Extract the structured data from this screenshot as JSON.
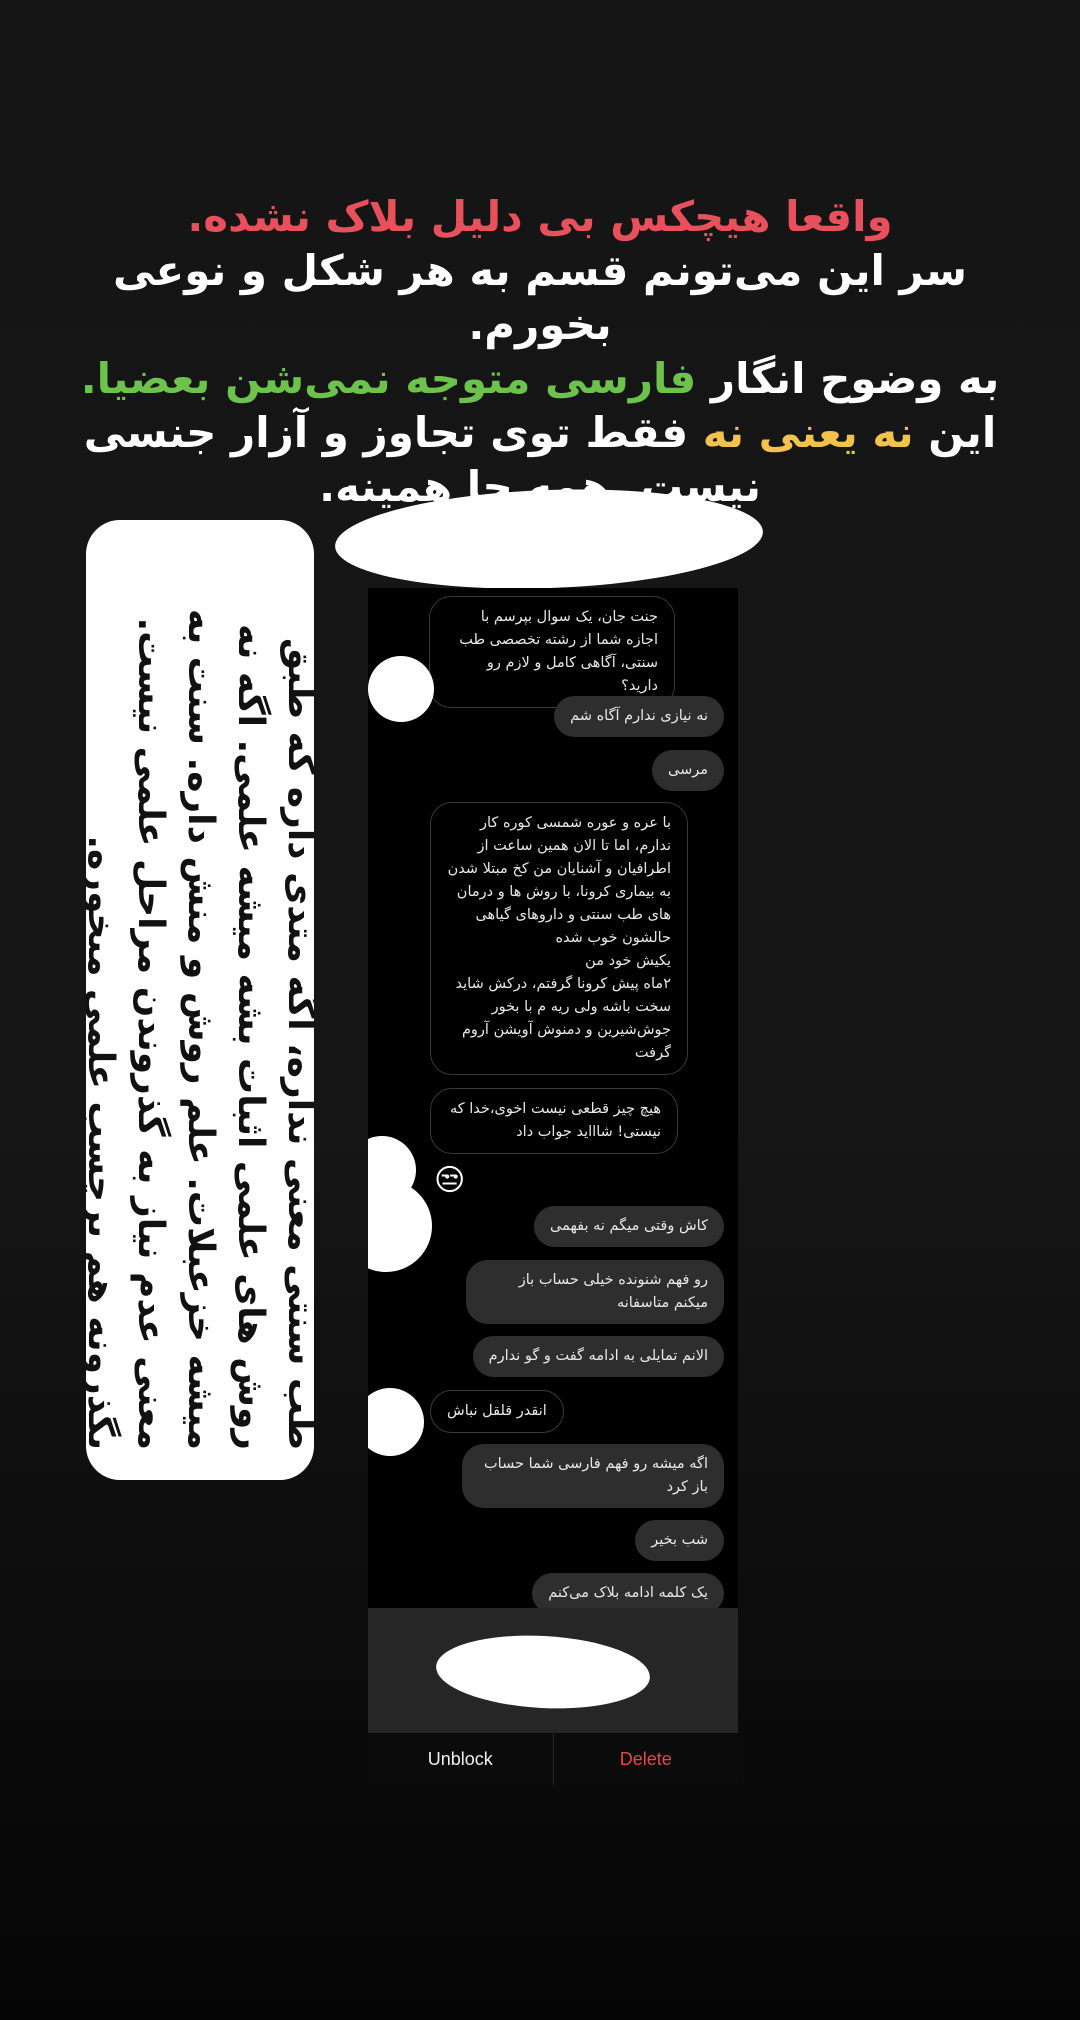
{
  "headline": {
    "line1": "واقعا هیچکس بی دلیل بلاک نشده.",
    "line2": "سر این می‌تونم قسم به هر شکل و نوعی بخورم.",
    "line3_a": "به وضوح انگار ",
    "line3_b": "فارسی متوجه نمی‌شن بعضیا.",
    "line4_a": "این ",
    "line4_b": "نه یعنی نه",
    "line4_c": " فقط توی تجاوز و آزار جنسی",
    "line5": "نیست. همه جا همینه.",
    "colors": {
      "red": "#e8505b",
      "green": "#6cc24a",
      "yellow": "#f2c14e"
    }
  },
  "side_note": {
    "text": "طب سنتی معنی نداره، اگه متدی داره که طبق روش های علمی اثبات بشه میشه علمی. اگه نه میشه خزعبلات. علم روش و منش داره. سنت به معنی عدم نیاز به گذروندن مراحل علمی نیست. بگذرونه هم برچسب علمی میخوره."
  },
  "chat": {
    "messages": [
      {
        "side": "theirs",
        "text": "جنت جان، یک سوال بپرسم با اجازه شما از رشته تخصصی طب سنتی، آگاهی کامل و لازم رو دارید؟"
      },
      {
        "side": "mine",
        "text": "نه نیازی ندارم آگاه شم"
      },
      {
        "side": "mine",
        "text": "مرسی"
      },
      {
        "side": "theirs",
        "text": "با عره و عوره شمسی کوره کار ندارم، اما تا الان همین ساعت  از اطرافیان و آشنایان من کخ مبتلا شدن به بیماری کرونا، با روش ها و درمان های طب سنتی و داروهای گیاهی حالشون خوب شده\nیکیش خود من\n۲ماه پیش کرونا گرفتم، درکش شاید سخت باشه ولی ریه م با بخور جوش‌شیرین  و دمنوش آویشن آروم گرفت"
      },
      {
        "side": "theirs",
        "text": "هیچ چیز قطعی نیست اخوی،خدا که نیستی! شاااید جواب داد"
      },
      {
        "side": "theirs",
        "text": "😒"
      },
      {
        "side": "mine",
        "text": "کاش وقتی میگم نه بفهمی"
      },
      {
        "side": "mine",
        "text": "رو فهم شنونده خیلی حساب باز میکنم متاسفانه"
      },
      {
        "side": "mine",
        "text": "الانم تمایلی به ادامه گفت و گو ندارم"
      },
      {
        "side": "theirs",
        "text": "انقدر قلقل نباش"
      },
      {
        "side": "mine",
        "text": "اگه میشه رو فهم فارسی شما حساب باز کرد"
      },
      {
        "side": "mine",
        "text": "شب بخیر"
      },
      {
        "side": "mine",
        "text": "یک کلمه ادامه بلاک می‌کنم"
      }
    ]
  },
  "actions": {
    "unblock": "Unblock",
    "delete": "Delete"
  }
}
